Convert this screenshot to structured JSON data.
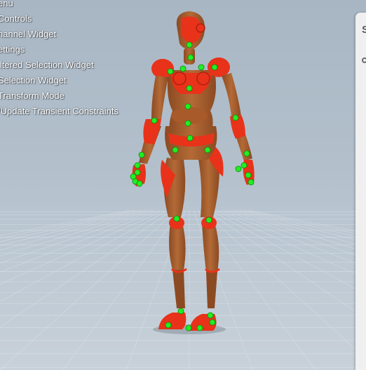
{
  "menu": {
    "items": [
      "enu",
      "Controls",
      "hannel Widget",
      "ettings",
      "iltered Selection Widget",
      "Selection Widget",
      "Transform Mode",
      "/Update Transient Constraints"
    ]
  },
  "side_panel": {
    "label": "S",
    "icon": "circle-icon"
  },
  "colors": {
    "viewport_top": "#a8b6c4",
    "viewport_bottom": "#c8d1d9",
    "grid_line": "#dfe6ec",
    "body_wood": "#a8602e",
    "body_red": "#e8321a",
    "control_point": "#22ee22"
  }
}
